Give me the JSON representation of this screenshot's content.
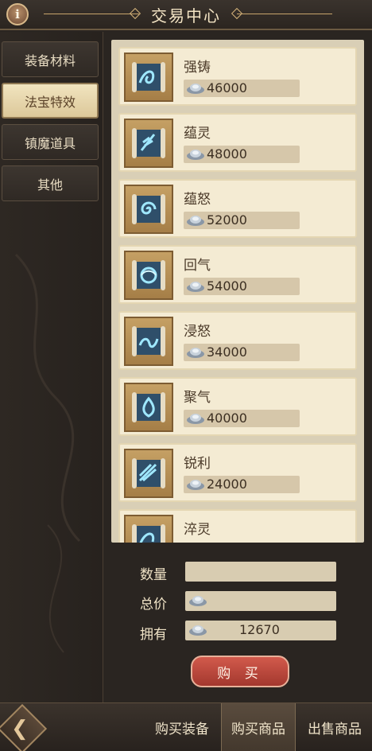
{
  "header": {
    "title": "交易中心",
    "info_label": "i"
  },
  "categories": [
    {
      "label": "装备材料",
      "active": false
    },
    {
      "label": "法宝特效",
      "active": true
    },
    {
      "label": "镇魔道具",
      "active": false
    },
    {
      "label": "其他",
      "active": false
    }
  ],
  "items": [
    {
      "name": "强铸",
      "price": "46000",
      "icon": "scroll-swirl-icon"
    },
    {
      "name": "蕴灵",
      "price": "48000",
      "icon": "scroll-feather-icon"
    },
    {
      "name": "蕴怒",
      "price": "52000",
      "icon": "scroll-spiral-icon"
    },
    {
      "name": "回气",
      "price": "54000",
      "icon": "scroll-vortex-icon"
    },
    {
      "name": "浸怒",
      "price": "34000",
      "icon": "scroll-wave-icon"
    },
    {
      "name": "聚气",
      "price": "40000",
      "icon": "scroll-flame-icon"
    },
    {
      "name": "锐利",
      "price": "24000",
      "icon": "scroll-blade-icon"
    },
    {
      "name": "淬灵",
      "price": "",
      "icon": "scroll-swirl-icon"
    }
  ],
  "form": {
    "quantity_label": "数量",
    "quantity_value": "",
    "total_label": "总价",
    "total_value": "",
    "owned_label": "拥有",
    "owned_value": "12670"
  },
  "buy_button": "购 买",
  "tabs": [
    {
      "label": "购买装备",
      "active": false
    },
    {
      "label": "购买商品",
      "active": true
    },
    {
      "label": "出售商品",
      "active": false
    }
  ],
  "colors": {
    "panel_bg": "#2a2521",
    "item_bg": "#f4ebd3",
    "icon_frame": "#b58d55",
    "buy_button": "#b8443a"
  }
}
